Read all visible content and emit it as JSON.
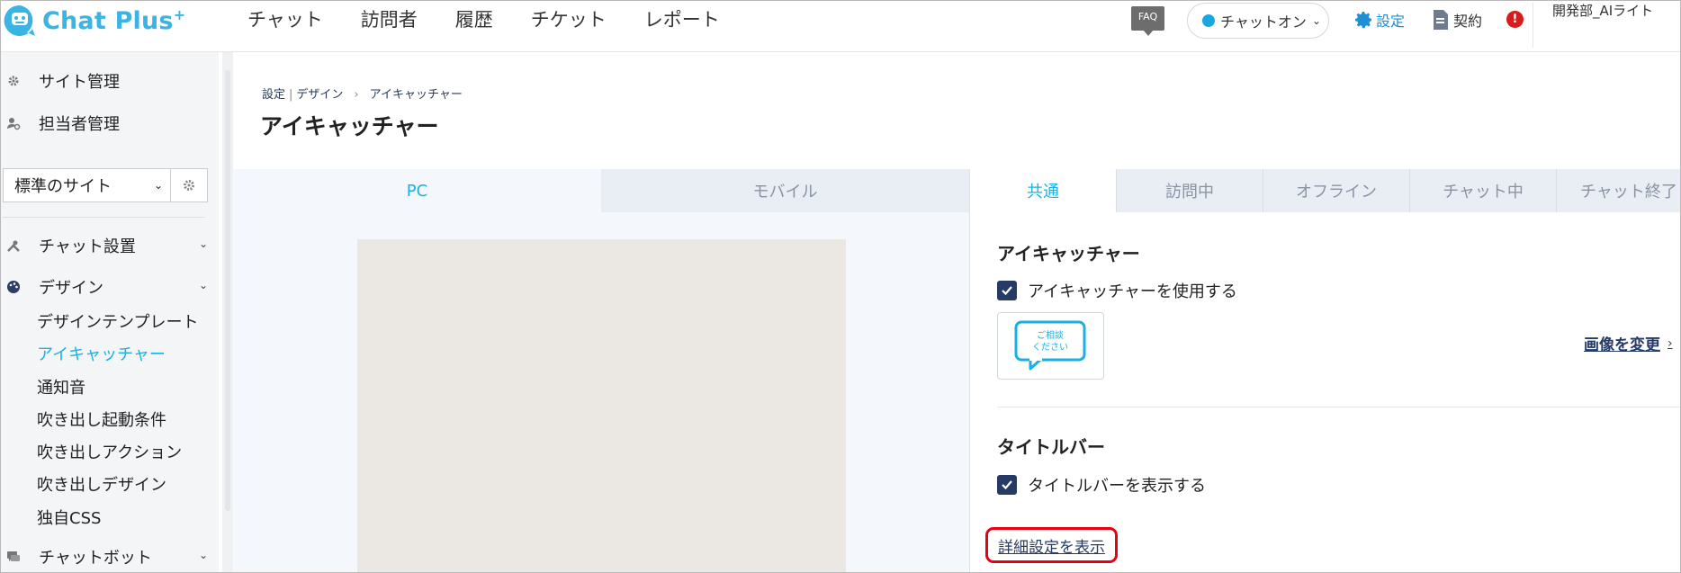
{
  "header": {
    "logo_text": "Chat Plus",
    "logo_sup": "+",
    "nav": [
      "チャット",
      "訪問者",
      "履歴",
      "チケット",
      "レポート"
    ],
    "faq_label": "FAQ",
    "status_label": "チャットオン",
    "settings_label": "設定",
    "contract_label": "契約",
    "alert_label": "!",
    "user_label": "開発部_AIライト"
  },
  "sidebar": {
    "site_admin": "サイト管理",
    "staff_admin": "担当者管理",
    "site_select_value": "標準のサイト",
    "chat_setup": "チャット設置",
    "design": "デザイン",
    "design_items": [
      "デザインテンプレート",
      "アイキャッチャー",
      "通知音",
      "吹き出し起動条件",
      "吹き出しアクション",
      "吹き出しデザイン",
      "独自CSS"
    ],
    "active_design_item": "アイキャッチャー",
    "chatbot": "チャットボット"
  },
  "breadcrumb": {
    "root": "設定",
    "parent": "デザイン",
    "arrow": "›",
    "current": "アイキャッチャー"
  },
  "page_title": "アイキャッチャー",
  "device_tabs": [
    "PC",
    "モバイル"
  ],
  "active_device_tab": "PC",
  "state_tabs": [
    "共通",
    "訪問中",
    "オフライン",
    "チャット中",
    "チャット終了"
  ],
  "active_state_tab": "共通",
  "panel": {
    "eyecatcher_title": "アイキャッチャー",
    "eyecatcher_checkbox_label": "アイキャッチャーを使用する",
    "eyecatcher_checked": true,
    "bubble_text_line1": "ご相談",
    "bubble_text_line2": "ください",
    "change_image_label": "画像を変更",
    "titlebar_title": "タイトルバー",
    "titlebar_checkbox_label": "タイトルバーを表示する",
    "titlebar_checked": true,
    "detail_link_label": "詳細設定を表示"
  },
  "colors": {
    "accent": "#1ab0e3",
    "navy": "#263a66",
    "highlight": "#e60012"
  }
}
